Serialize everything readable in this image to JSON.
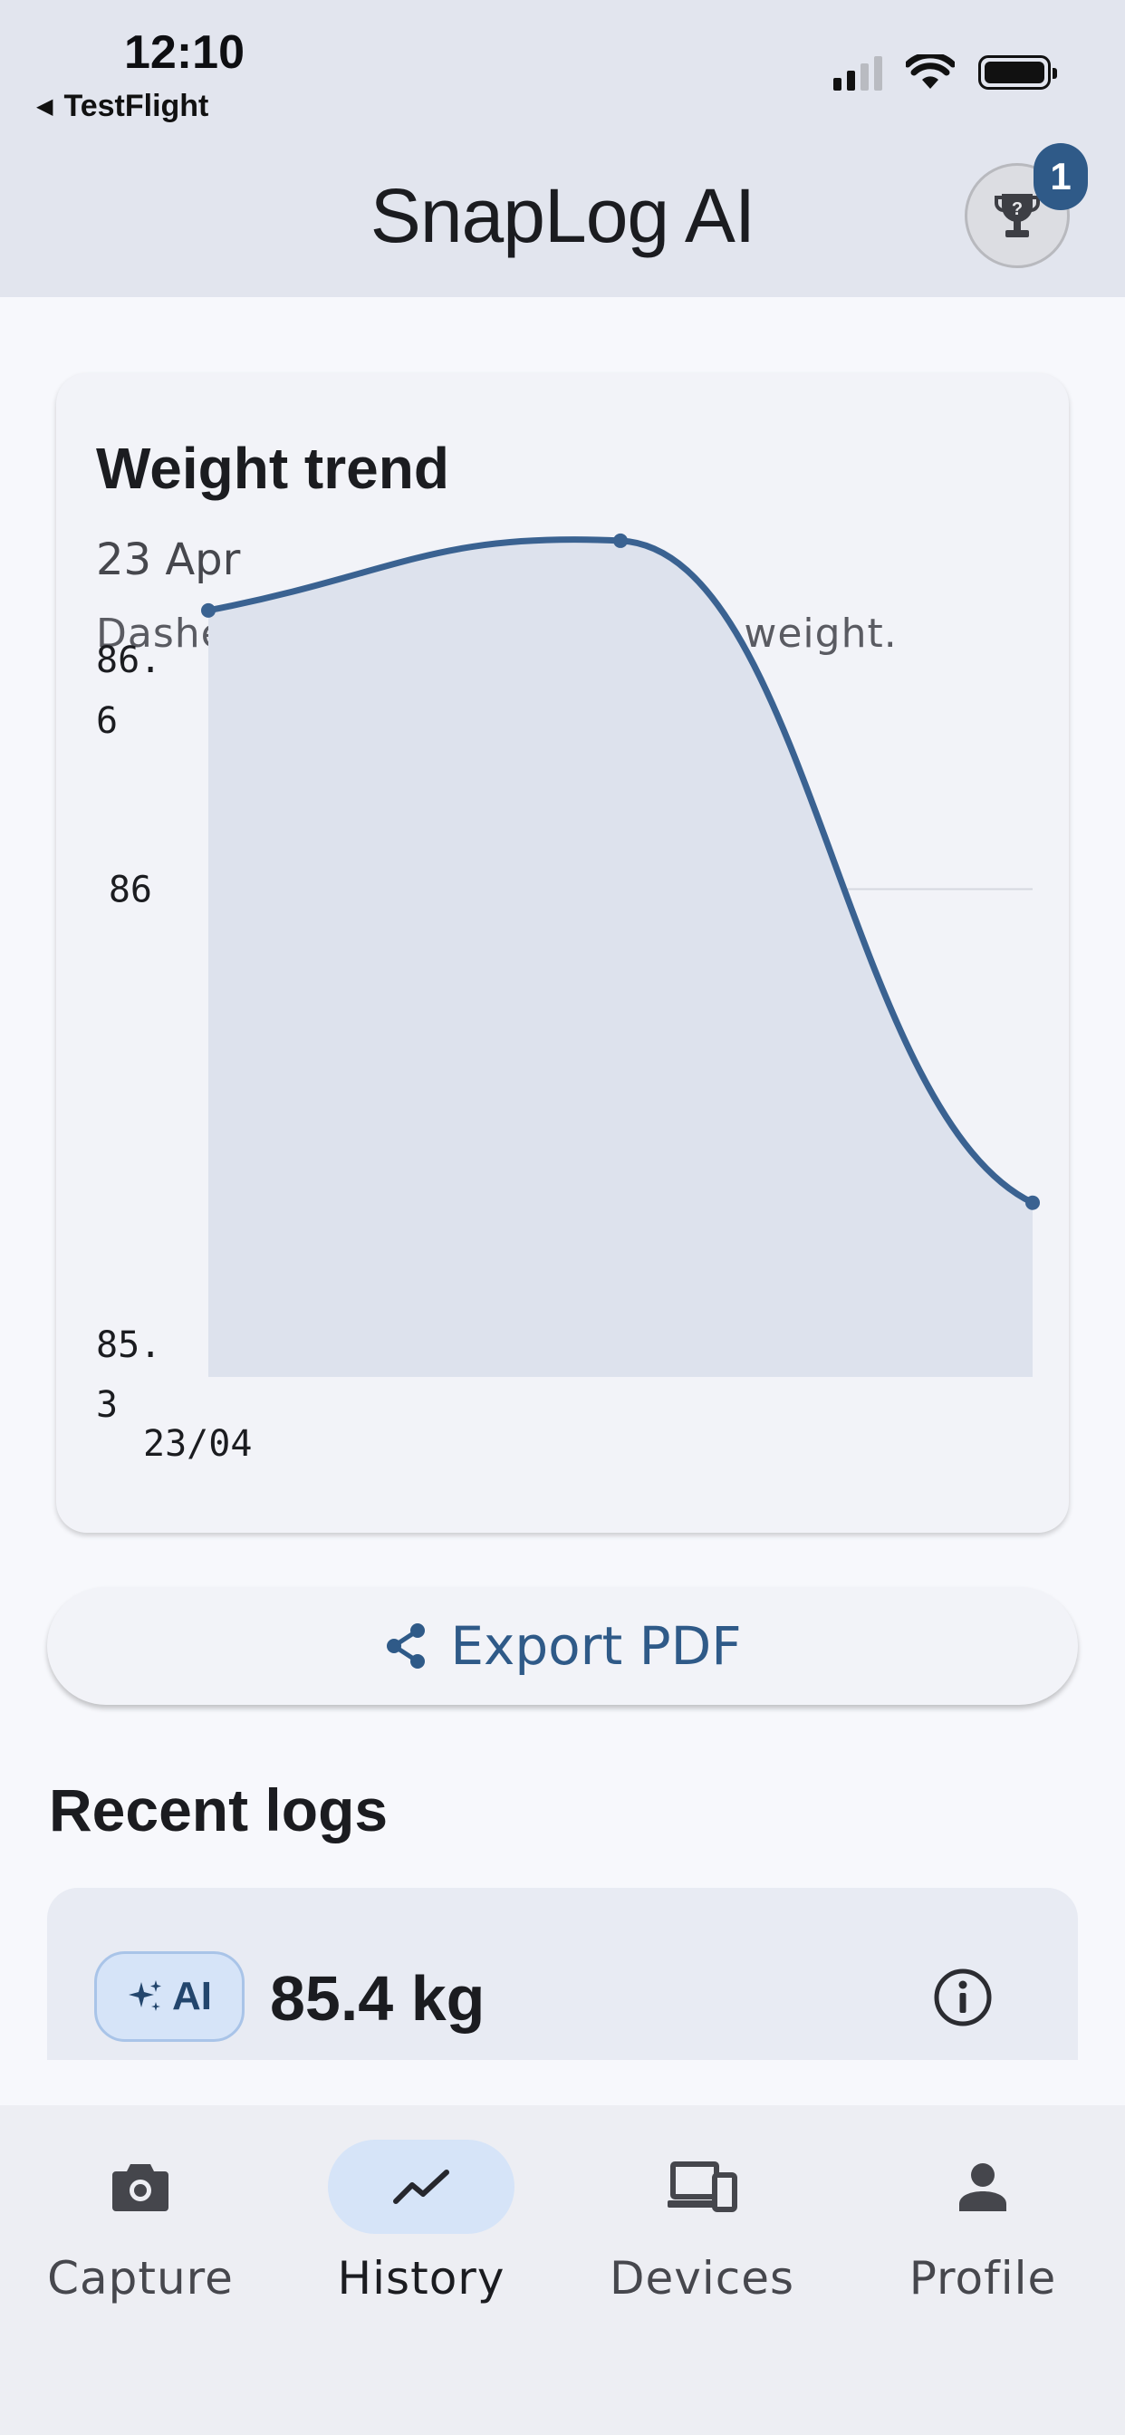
{
  "status_bar": {
    "time": "12:10",
    "back_app": "TestFlight",
    "icons": [
      "cellular-signal-icon",
      "wifi-icon",
      "battery-icon"
    ]
  },
  "app_bar": {
    "title": "SnapLog AI",
    "trophy_icon": "trophy-help-icon",
    "badge_count": "1"
  },
  "weight_card": {
    "title": "Weight trend",
    "date": "23 Apr",
    "note": "Dashed line shows your target weight."
  },
  "chart_data": {
    "type": "area",
    "title": "Weight trend",
    "xlabel": "",
    "ylabel": "",
    "x_tick_labels": [
      "23/04"
    ],
    "y_tick_labels": [
      {
        "value": 86.6,
        "label": "86.6"
      },
      {
        "value": 86.0,
        "label": "86"
      },
      {
        "value": 85.3,
        "label": "85.3"
      }
    ],
    "ylim": [
      85.3,
      86.6
    ],
    "grid": "single horizontal line at 86",
    "series": [
      {
        "points": [
          {
            "i": 0,
            "y": 86.4
          },
          {
            "i": 1,
            "y": 86.5
          },
          {
            "i": 2,
            "y": 85.55
          }
        ],
        "color": "#3a6291"
      }
    ],
    "fill_color": "#dde2ed"
  },
  "export_button": {
    "label": "Export PDF",
    "icon": "share-icon"
  },
  "recent_logs": {
    "title": "Recent logs",
    "items": [
      {
        "chip_label": "AI",
        "chip_icon": "sparkle-icon",
        "value": "85.4 kg",
        "info_icon": "info-icon"
      }
    ]
  },
  "bottom_nav": {
    "items": [
      {
        "label": "Capture",
        "icon": "camera-icon",
        "active": false
      },
      {
        "label": "History",
        "icon": "trend-line-icon",
        "active": true
      },
      {
        "label": "Devices",
        "icon": "devices-icon",
        "active": false
      },
      {
        "label": "Profile",
        "icon": "person-icon",
        "active": false
      }
    ]
  },
  "colors": {
    "accent": "#2f5a88",
    "line": "#3a6291",
    "header_bg": "#e2e5ee",
    "chip_bg": "#d6e4f8"
  }
}
